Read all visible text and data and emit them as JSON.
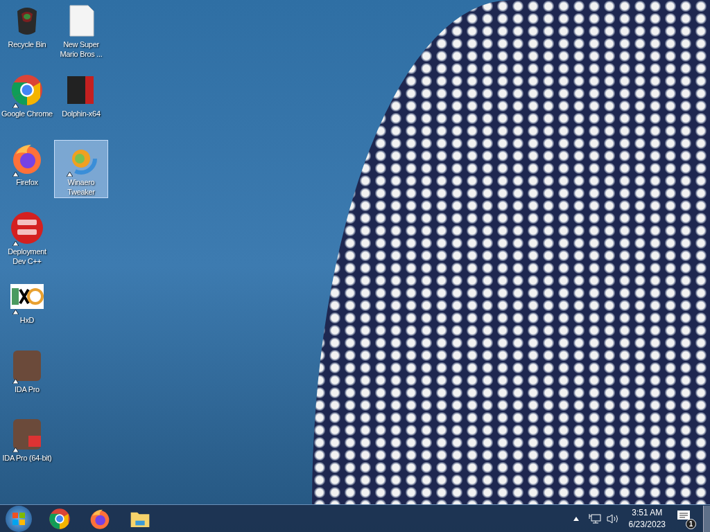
{
  "desktop_icons": [
    {
      "kind": "recycle",
      "label": "Recycle Bin",
      "shortcut": false,
      "selected": false
    },
    {
      "kind": "chrome",
      "label": "Google Chrome",
      "shortcut": true,
      "selected": false
    },
    {
      "kind": "firefox",
      "label": "Firefox",
      "shortcut": true,
      "selected": false
    },
    {
      "kind": "devcpp",
      "label": "Deployment Dev C++",
      "shortcut": true,
      "selected": false
    },
    {
      "kind": "hxd",
      "label": "HxD",
      "shortcut": true,
      "selected": false
    },
    {
      "kind": "portrait",
      "label": "IDA Pro",
      "shortcut": true,
      "selected": false
    },
    {
      "kind": "portrait64",
      "label": "IDA Pro (64-bit)",
      "shortcut": true,
      "selected": false
    },
    {
      "kind": "file",
      "label": "New Super Mario Bros ...",
      "shortcut": false,
      "selected": false
    },
    {
      "kind": "dolphin",
      "label": "Dolphin-x64",
      "shortcut": false,
      "selected": false
    },
    {
      "kind": "winaero",
      "label": "Winaero Tweaker",
      "shortcut": true,
      "selected": true
    }
  ],
  "taskbar": {
    "pinned": [
      {
        "kind": "chrome"
      },
      {
        "kind": "firefox"
      },
      {
        "kind": "folder"
      }
    ],
    "time": "3:51 AM",
    "date": "6/23/2023",
    "notifications": "1"
  }
}
